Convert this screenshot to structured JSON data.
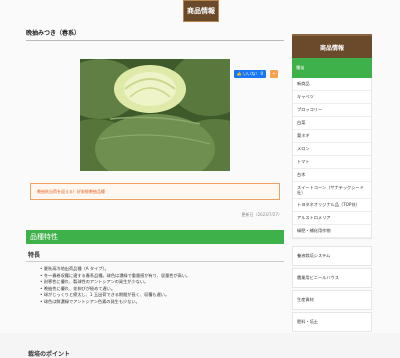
{
  "header": {
    "badge": "商品情報"
  },
  "page": {
    "title": "晩抽みつき（春系）"
  },
  "share": {
    "x_label": "𝕏",
    "like_label": "👍 いいね！ 0",
    "rss_label": "⌁"
  },
  "notice": {
    "text": "晩抽秋出荷を迎える！好栄極晩抽品種"
  },
  "date": {
    "text": "更新日（2023/7/27）"
  },
  "section": {
    "heading": "品種特性"
  },
  "features": {
    "title": "特長",
    "items": [
      "夏秋高冷地出荷品種（A タイプ）。",
      "冬～春巻収穫に適する春系品種。球色は濃緑で重量感が有り、収量性が高い。",
      "耐寒性に優れ、裂球性のアントシアンの発生が少ない。",
      "晩抽性に優れ、花伸びが極めて遅い。",
      "球がじっくりと締太し、1 玉出荷できる期間が長く、収穫も遅い。",
      "球色は鮮濃緑でアントシアン色素の発生も少ない。"
    ]
  },
  "cultivation": {
    "title": "栽培のポイント"
  },
  "sidebar": {
    "head": "商品情報",
    "active": "種苗",
    "items": [
      "新商品",
      "キャベツ",
      "ブロッコリー",
      "白菜",
      "葉ネギ",
      "メロン",
      "トマト",
      "台木",
      "スイートコーン（サナテックシード社）",
      "トヨタネオリジナル品（TOP技）",
      "アルストロメリア",
      "緑肥・補化用作物"
    ],
    "categories": [
      "養液栽培システム",
      "農業用ビニールハウス",
      "生産資材",
      "肥料・培土"
    ]
  }
}
